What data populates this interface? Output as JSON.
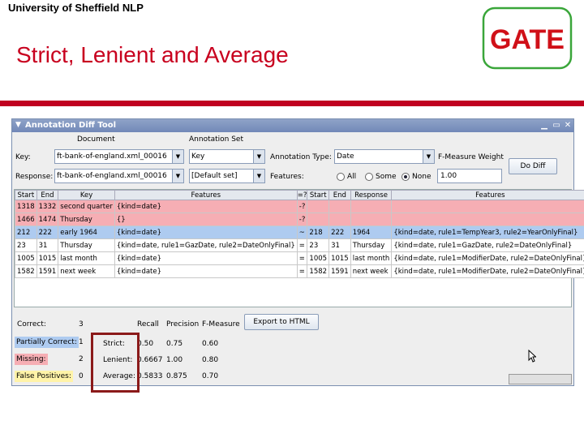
{
  "slide": {
    "header": "University of Sheffield NLP",
    "title": "Strict, Lenient and Average",
    "logo_text": "GATE",
    "accent_color": "#c00020"
  },
  "window": {
    "title": "Annotation Diff Tool"
  },
  "controls": {
    "col_document": "Document",
    "col_annotation_set": "Annotation Set",
    "key_label": "Key:",
    "key_document": "ft-bank-of-england.xml_00016",
    "key_set": "Key",
    "annotation_type_label": "Annotation Type:",
    "annotation_type": "Date",
    "fmeasure_weight_label": "F-Measure Weight",
    "response_label": "Response:",
    "response_document": "ft-bank-of-england.xml_00016",
    "response_set": "[Default set]",
    "features_label": "Features:",
    "features_options": [
      "All",
      "Some",
      "None"
    ],
    "features_selected": "None",
    "fmeasure_weight": "1.00",
    "do_diff_label": "Do Diff"
  },
  "table": {
    "headers": [
      "Start",
      "End",
      "Key",
      "Features",
      "=?",
      "Start",
      "End",
      "Response",
      "Features"
    ],
    "rows": [
      {
        "type": "missing",
        "cells": [
          "1318",
          "1332",
          "second quarter",
          "{kind=date}",
          "-?",
          "",
          "",
          "",
          ""
        ]
      },
      {
        "type": "missing",
        "cells": [
          "1466",
          "1474",
          "Thursday",
          "{}",
          "-?",
          "",
          "",
          "",
          ""
        ]
      },
      {
        "type": "partial",
        "cells": [
          "212",
          "222",
          "early 1964",
          "{kind=date}",
          "~",
          "218",
          "222",
          "1964",
          "{kind=date, rule1=TempYear3, rule2=YearOnlyFinal}"
        ]
      },
      {
        "type": "correct",
        "cells": [
          "23",
          "31",
          "Thursday",
          "{kind=date, rule1=GazDate, rule2=DateOnlyFinal}",
          "=",
          "23",
          "31",
          "Thursday",
          "{kind=date, rule1=GazDate, rule2=DateOnlyFinal}"
        ]
      },
      {
        "type": "correct",
        "cells": [
          "1005",
          "1015",
          "last month",
          "{kind=date}",
          "=",
          "1005",
          "1015",
          "last month",
          "{kind=date, rule1=ModifierDate, rule2=DateOnlyFinal}"
        ]
      },
      {
        "type": "correct",
        "cells": [
          "1582",
          "1591",
          "next week",
          "{kind=date}",
          "=",
          "1582",
          "1591",
          "next week",
          "{kind=date, rule1=ModifierDate, rule2=DateOnlyFinal}"
        ]
      }
    ]
  },
  "stats": {
    "correct_label": "Correct:",
    "correct_count": "3",
    "partial_label": "Partially Correct:",
    "partial_count": "1",
    "missing_label": "Missing:",
    "missing_count": "2",
    "false_pos_label": "False Positives:",
    "false_pos_count": "0",
    "col_recall": "Recall",
    "col_precision": "Precision",
    "col_fmeasure": "F-Measure",
    "export_label": "Export to HTML",
    "rows": [
      {
        "name": "Strict:",
        "recall": "0.50",
        "precision": "0.75",
        "fmeasure": "0.60"
      },
      {
        "name": "Lenient:",
        "recall": "0.6667",
        "precision": "1.00",
        "fmeasure": "0.80"
      },
      {
        "name": "Average:",
        "recall": "0.5833",
        "precision": "0.875",
        "fmeasure": "0.70"
      }
    ],
    "colors": {
      "partial": "#aecbf0",
      "missing": "#f6aeb4",
      "false_pos": "#fff3a8"
    }
  }
}
